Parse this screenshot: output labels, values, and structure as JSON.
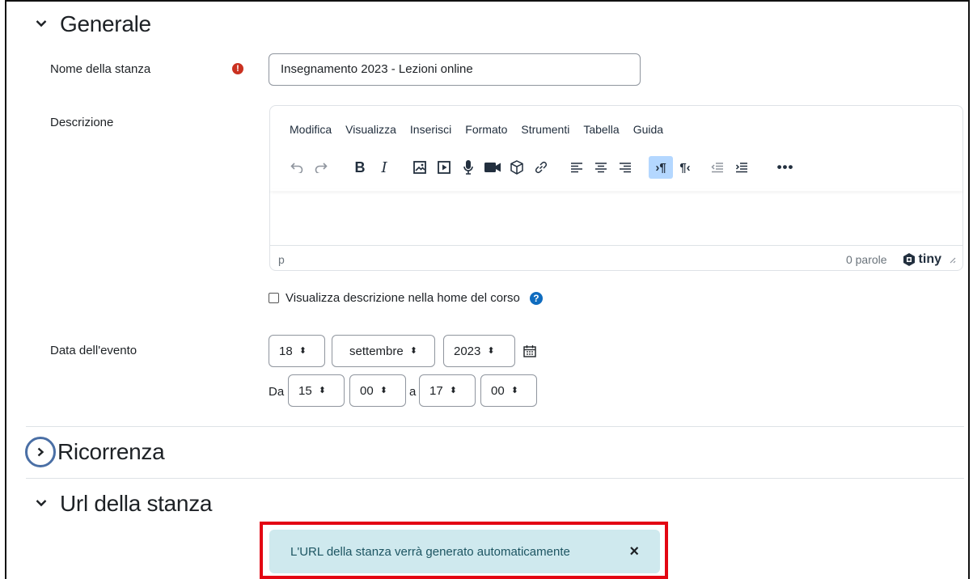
{
  "sections": {
    "generale": {
      "title": "Generale"
    },
    "ricorrenza": {
      "title": "Ricorrenza"
    },
    "url": {
      "title": "Url della stanza"
    }
  },
  "fields": {
    "room_name": {
      "label": "Nome della stanza",
      "value": "Insegnamento 2023 - Lezioni online"
    },
    "description": {
      "label": "Descrizione"
    },
    "show_description": {
      "label": "Visualizza descrizione nella home del corso"
    },
    "event_date": {
      "label": "Data dell'evento",
      "day": "18",
      "month": "settembre",
      "year": "2023",
      "from_label": "Da",
      "from_hour": "15",
      "from_minute": "00",
      "to_label": "a",
      "to_hour": "17",
      "to_minute": "00"
    }
  },
  "editor": {
    "menu": [
      "Modifica",
      "Visualizza",
      "Inserisci",
      "Formato",
      "Strumenti",
      "Tabella",
      "Guida"
    ],
    "status_path": "p",
    "word_count": "0 parole",
    "brand": "tiny"
  },
  "alert": {
    "message": "L'URL della stanza verrà generato automaticamente",
    "close": "×"
  },
  "colors": {
    "required": "#ca3120",
    "help": "#0f6cbf",
    "alert_bg": "#cfe9ee",
    "highlight": "#e30613"
  }
}
